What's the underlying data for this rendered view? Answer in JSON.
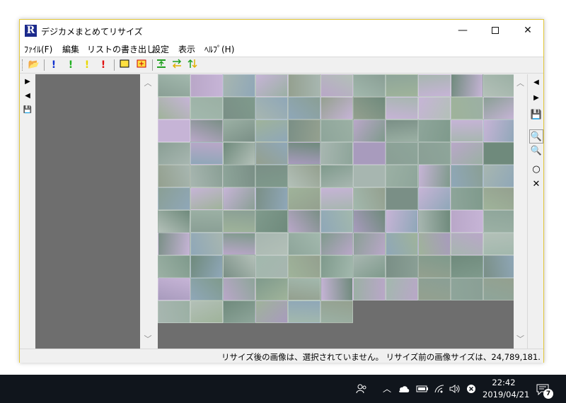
{
  "window": {
    "title": "デジカメまとめてリサイズ",
    "app_icon": "R",
    "controls": {
      "minimize": "—",
      "close": "✕"
    }
  },
  "menu": [
    {
      "label": "ﾌｧｲﾙ(F)"
    },
    {
      "label": "編集"
    },
    {
      "label": "リストの書き出し"
    },
    {
      "label": "設定"
    },
    {
      "label": "表示"
    },
    {
      "label": "ﾍﾙﾌﾟ(H)"
    }
  ],
  "toolbar": {
    "open_icon": "📂",
    "mark_blue": "!",
    "mark_green": "!",
    "mark_yellow": "!",
    "mark_red": "!",
    "colors": {
      "blue": "#1030d0",
      "green": "#20b020",
      "yellow": "#e8d800",
      "red": "#e01010"
    }
  },
  "left_strip": {
    "next": "▶",
    "prev": "◀",
    "save": "💾"
  },
  "right_strip": {
    "prev": "◀",
    "next": "▶",
    "save": "💾",
    "zoom_fit": "🔍",
    "zoom": "🔍",
    "circle": "○",
    "cross": "✕"
  },
  "status": {
    "message": "リサイズ後の画像は、選択されていません。 リサイズ前の画像サイズは、24,789,181."
  },
  "taskbar": {
    "time": "22:42",
    "date": "2019/04/21",
    "notification_count": "7"
  }
}
